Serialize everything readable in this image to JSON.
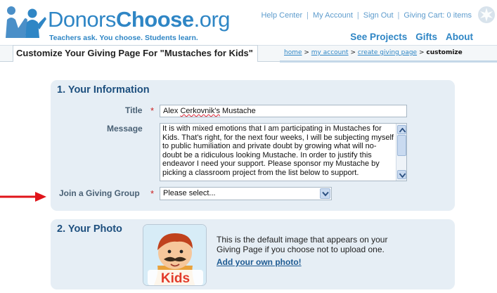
{
  "header": {
    "logo_donors": "Donors",
    "logo_choose": "Choose",
    "logo_org": ".org",
    "tagline": "Teachers ask. You choose. Students learn.",
    "top_links": [
      "Help Center",
      "My Account",
      "Sign Out",
      "Giving Cart: 0 items"
    ],
    "nav": [
      "See Projects",
      "Gifts",
      "About"
    ]
  },
  "page": {
    "title": "Customize Your Giving Page For \"Mustaches for Kids\"",
    "breadcrumb": {
      "home": "home",
      "sep": " > ",
      "my_account": "my account",
      "create": "create giving page",
      "current": "customize"
    }
  },
  "info": {
    "heading": "1. Your Information",
    "title_label": "Title",
    "title_value_a": "Alex ",
    "title_value_b": "Cerkovnik's",
    "title_value_c": " Mustache",
    "message_label": "Message",
    "message_value": "It is with mixed emotions that I am participating in Mustaches for Kids. That's right, for the next four weeks, I will be subjecting myself to public humiliation and private doubt by growing what will no-doubt be a ridiculous looking Mustache. In order to justify this endeavor I need your support. Please sponsor my Mustache by picking a classroom project from the list below to support.",
    "group_label": "Join a Giving Group",
    "group_selected": "Please select...",
    "required_mark": "*"
  },
  "photo": {
    "heading": "2. Your Photo",
    "description": "This is the default image that appears on your Giving Page if you choose not to upload one.",
    "upload_link": "Add your own photo!",
    "image_caption": "Kids"
  },
  "colors": {
    "brand_blue": "#2f86c5",
    "panel_bg": "#e6eef5",
    "heading": "#1d4f7e",
    "required": "#cc1d1d",
    "arrow": "#e0141a"
  }
}
